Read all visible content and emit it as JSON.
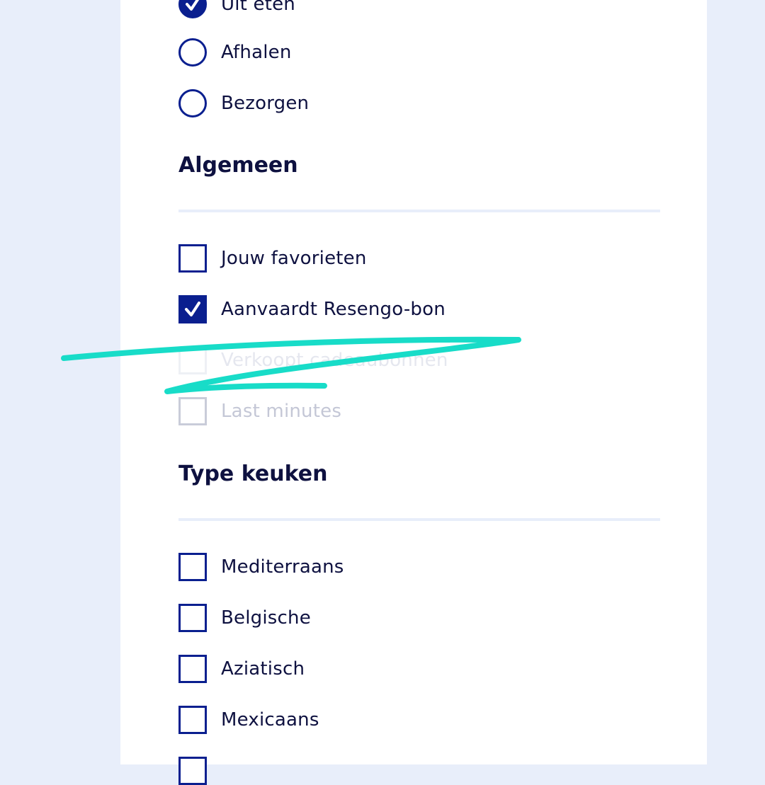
{
  "service": {
    "options": [
      {
        "label": "Uit eten",
        "checked": true
      },
      {
        "label": "Afhalen",
        "checked": false
      },
      {
        "label": "Bezorgen",
        "checked": false
      }
    ]
  },
  "general": {
    "title": "Algemeen",
    "options": [
      {
        "label": "Jouw favorieten",
        "checked": false
      },
      {
        "label": "Aanvaardt Resengo-bon",
        "checked": true
      },
      {
        "label": "Verkoopt cadeaubonnen",
        "checked": false,
        "state": "struck-through"
      },
      {
        "label": "Last minutes",
        "checked": false,
        "state": "disabled"
      }
    ]
  },
  "cuisine": {
    "title": "Type keuken",
    "options": [
      {
        "label": "Mediterraans",
        "checked": false
      },
      {
        "label": "Belgische",
        "checked": false
      },
      {
        "label": "Aziatisch",
        "checked": false
      },
      {
        "label": "Mexicaans",
        "checked": false
      }
    ]
  },
  "colors": {
    "accent": "#0a1f8f",
    "text": "#0e1140",
    "background": "#e8eefa",
    "scribble": "#18dcc8",
    "disabled": "#c4c7d6"
  },
  "icons": {
    "checked_glyph": "checkmark-icon",
    "scribble": "strikethrough-scribble"
  }
}
